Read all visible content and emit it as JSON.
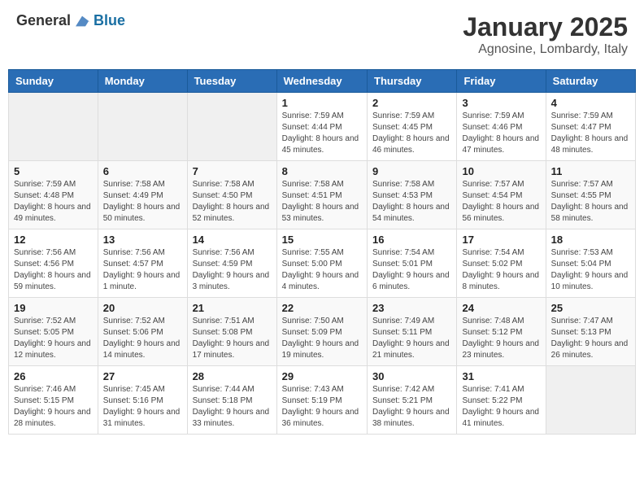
{
  "logo": {
    "general": "General",
    "blue": "Blue"
  },
  "header": {
    "month": "January 2025",
    "location": "Agnosine, Lombardy, Italy"
  },
  "weekdays": [
    "Sunday",
    "Monday",
    "Tuesday",
    "Wednesday",
    "Thursday",
    "Friday",
    "Saturday"
  ],
  "weeks": [
    [
      {
        "day": "",
        "sunrise": "",
        "sunset": "",
        "daylight": ""
      },
      {
        "day": "",
        "sunrise": "",
        "sunset": "",
        "daylight": ""
      },
      {
        "day": "",
        "sunrise": "",
        "sunset": "",
        "daylight": ""
      },
      {
        "day": "1",
        "sunrise": "Sunrise: 7:59 AM",
        "sunset": "Sunset: 4:44 PM",
        "daylight": "Daylight: 8 hours and 45 minutes."
      },
      {
        "day": "2",
        "sunrise": "Sunrise: 7:59 AM",
        "sunset": "Sunset: 4:45 PM",
        "daylight": "Daylight: 8 hours and 46 minutes."
      },
      {
        "day": "3",
        "sunrise": "Sunrise: 7:59 AM",
        "sunset": "Sunset: 4:46 PM",
        "daylight": "Daylight: 8 hours and 47 minutes."
      },
      {
        "day": "4",
        "sunrise": "Sunrise: 7:59 AM",
        "sunset": "Sunset: 4:47 PM",
        "daylight": "Daylight: 8 hours and 48 minutes."
      }
    ],
    [
      {
        "day": "5",
        "sunrise": "Sunrise: 7:59 AM",
        "sunset": "Sunset: 4:48 PM",
        "daylight": "Daylight: 8 hours and 49 minutes."
      },
      {
        "day": "6",
        "sunrise": "Sunrise: 7:58 AM",
        "sunset": "Sunset: 4:49 PM",
        "daylight": "Daylight: 8 hours and 50 minutes."
      },
      {
        "day": "7",
        "sunrise": "Sunrise: 7:58 AM",
        "sunset": "Sunset: 4:50 PM",
        "daylight": "Daylight: 8 hours and 52 minutes."
      },
      {
        "day": "8",
        "sunrise": "Sunrise: 7:58 AM",
        "sunset": "Sunset: 4:51 PM",
        "daylight": "Daylight: 8 hours and 53 minutes."
      },
      {
        "day": "9",
        "sunrise": "Sunrise: 7:58 AM",
        "sunset": "Sunset: 4:53 PM",
        "daylight": "Daylight: 8 hours and 54 minutes."
      },
      {
        "day": "10",
        "sunrise": "Sunrise: 7:57 AM",
        "sunset": "Sunset: 4:54 PM",
        "daylight": "Daylight: 8 hours and 56 minutes."
      },
      {
        "day": "11",
        "sunrise": "Sunrise: 7:57 AM",
        "sunset": "Sunset: 4:55 PM",
        "daylight": "Daylight: 8 hours and 58 minutes."
      }
    ],
    [
      {
        "day": "12",
        "sunrise": "Sunrise: 7:56 AM",
        "sunset": "Sunset: 4:56 PM",
        "daylight": "Daylight: 8 hours and 59 minutes."
      },
      {
        "day": "13",
        "sunrise": "Sunrise: 7:56 AM",
        "sunset": "Sunset: 4:57 PM",
        "daylight": "Daylight: 9 hours and 1 minute."
      },
      {
        "day": "14",
        "sunrise": "Sunrise: 7:56 AM",
        "sunset": "Sunset: 4:59 PM",
        "daylight": "Daylight: 9 hours and 3 minutes."
      },
      {
        "day": "15",
        "sunrise": "Sunrise: 7:55 AM",
        "sunset": "Sunset: 5:00 PM",
        "daylight": "Daylight: 9 hours and 4 minutes."
      },
      {
        "day": "16",
        "sunrise": "Sunrise: 7:54 AM",
        "sunset": "Sunset: 5:01 PM",
        "daylight": "Daylight: 9 hours and 6 minutes."
      },
      {
        "day": "17",
        "sunrise": "Sunrise: 7:54 AM",
        "sunset": "Sunset: 5:02 PM",
        "daylight": "Daylight: 9 hours and 8 minutes."
      },
      {
        "day": "18",
        "sunrise": "Sunrise: 7:53 AM",
        "sunset": "Sunset: 5:04 PM",
        "daylight": "Daylight: 9 hours and 10 minutes."
      }
    ],
    [
      {
        "day": "19",
        "sunrise": "Sunrise: 7:52 AM",
        "sunset": "Sunset: 5:05 PM",
        "daylight": "Daylight: 9 hours and 12 minutes."
      },
      {
        "day": "20",
        "sunrise": "Sunrise: 7:52 AM",
        "sunset": "Sunset: 5:06 PM",
        "daylight": "Daylight: 9 hours and 14 minutes."
      },
      {
        "day": "21",
        "sunrise": "Sunrise: 7:51 AM",
        "sunset": "Sunset: 5:08 PM",
        "daylight": "Daylight: 9 hours and 17 minutes."
      },
      {
        "day": "22",
        "sunrise": "Sunrise: 7:50 AM",
        "sunset": "Sunset: 5:09 PM",
        "daylight": "Daylight: 9 hours and 19 minutes."
      },
      {
        "day": "23",
        "sunrise": "Sunrise: 7:49 AM",
        "sunset": "Sunset: 5:11 PM",
        "daylight": "Daylight: 9 hours and 21 minutes."
      },
      {
        "day": "24",
        "sunrise": "Sunrise: 7:48 AM",
        "sunset": "Sunset: 5:12 PM",
        "daylight": "Daylight: 9 hours and 23 minutes."
      },
      {
        "day": "25",
        "sunrise": "Sunrise: 7:47 AM",
        "sunset": "Sunset: 5:13 PM",
        "daylight": "Daylight: 9 hours and 26 minutes."
      }
    ],
    [
      {
        "day": "26",
        "sunrise": "Sunrise: 7:46 AM",
        "sunset": "Sunset: 5:15 PM",
        "daylight": "Daylight: 9 hours and 28 minutes."
      },
      {
        "day": "27",
        "sunrise": "Sunrise: 7:45 AM",
        "sunset": "Sunset: 5:16 PM",
        "daylight": "Daylight: 9 hours and 31 minutes."
      },
      {
        "day": "28",
        "sunrise": "Sunrise: 7:44 AM",
        "sunset": "Sunset: 5:18 PM",
        "daylight": "Daylight: 9 hours and 33 minutes."
      },
      {
        "day": "29",
        "sunrise": "Sunrise: 7:43 AM",
        "sunset": "Sunset: 5:19 PM",
        "daylight": "Daylight: 9 hours and 36 minutes."
      },
      {
        "day": "30",
        "sunrise": "Sunrise: 7:42 AM",
        "sunset": "Sunset: 5:21 PM",
        "daylight": "Daylight: 9 hours and 38 minutes."
      },
      {
        "day": "31",
        "sunrise": "Sunrise: 7:41 AM",
        "sunset": "Sunset: 5:22 PM",
        "daylight": "Daylight: 9 hours and 41 minutes."
      },
      {
        "day": "",
        "sunrise": "",
        "sunset": "",
        "daylight": ""
      }
    ]
  ]
}
